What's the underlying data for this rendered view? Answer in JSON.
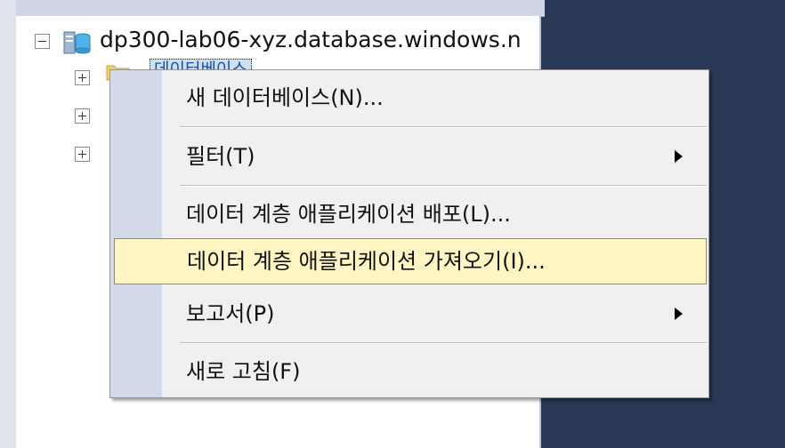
{
  "object_explorer": {
    "server_node": {
      "label": "dp300-lab06-xyz.database.windows.n"
    },
    "selected_node": {
      "label": "데이터베이스"
    }
  },
  "context_menu": {
    "items": [
      {
        "label": "새 데이터베이스(N)...",
        "submenu": false
      },
      {
        "label": "필터(T)",
        "submenu": true
      },
      {
        "label": "데이터 계층 애플리케이션 배포(L)...",
        "submenu": false
      },
      {
        "label": "데이터 계층 애플리케이션 가져오기(I)...",
        "submenu": false,
        "highlighted": true
      },
      {
        "label": "보고서(P)",
        "submenu": true
      },
      {
        "label": "새로 고침(F)",
        "submenu": false
      }
    ]
  }
}
